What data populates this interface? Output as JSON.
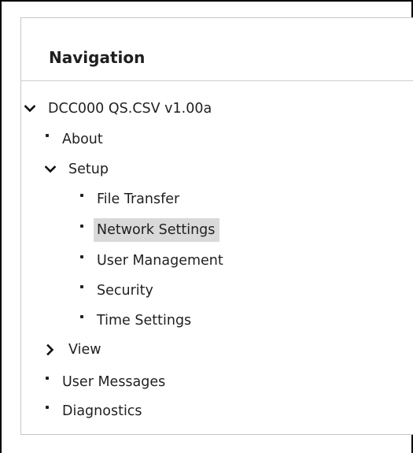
{
  "navigation": {
    "title": "Navigation",
    "tree": {
      "root": {
        "label": "DCC000 QS.CSV v1.00a",
        "icon": "chevron-down-icon",
        "expanded": true
      },
      "about": {
        "label": "About"
      },
      "setup": {
        "label": "Setup",
        "icon": "chevron-down-icon",
        "expanded": true,
        "children": [
          {
            "label": "File Transfer"
          },
          {
            "label": "Network Settings",
            "selected": true
          },
          {
            "label": "User Management"
          },
          {
            "label": "Security"
          },
          {
            "label": "Time Settings"
          }
        ]
      },
      "view": {
        "label": "View",
        "icon": "chevron-right-icon",
        "expanded": false
      },
      "user_messages": {
        "label": "User Messages"
      },
      "diagnostics": {
        "label": "Diagnostics"
      }
    },
    "selected_color": "#d9d9d9"
  }
}
